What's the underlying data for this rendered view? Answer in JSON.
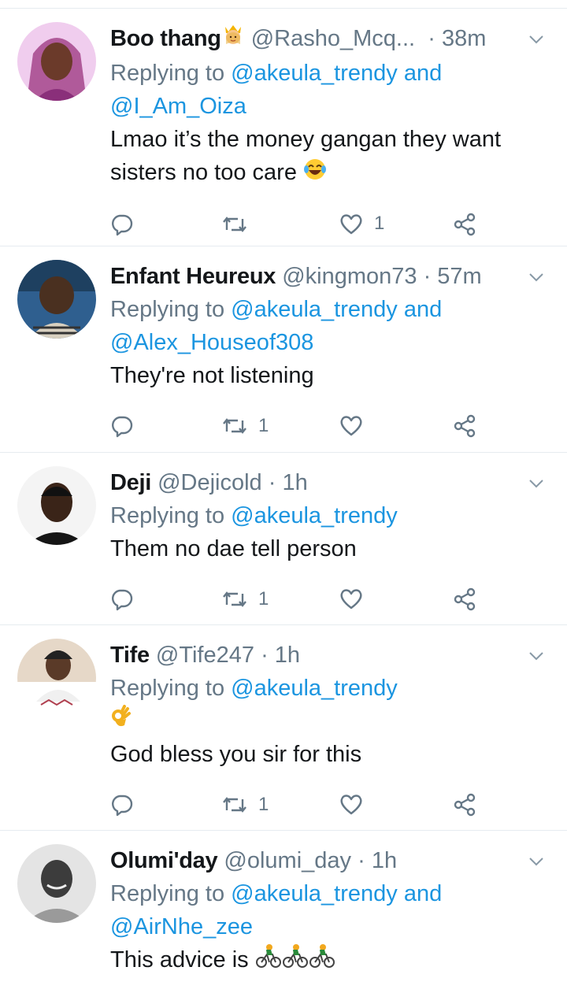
{
  "tweets": [
    {
      "name": "Boo thang",
      "handle": "@Rasho_Mcq...",
      "separator": "·",
      "time": "38m",
      "reply_prefix": "Replying to",
      "mentions": [
        "@akeula_trendy",
        "@I_Am_Oiza"
      ],
      "joiner": "and",
      "text": "Lmao it’s the money gangan they want sisters no too care",
      "retweets": "",
      "likes": "1",
      "avatar_colors": [
        "#e9c7f2",
        "#6b2f6e"
      ]
    },
    {
      "name": "Enfant Heureux",
      "handle": "@kingmon73",
      "separator": "·",
      "time": "57m",
      "reply_prefix": "Replying to",
      "mentions": [
        "@akeula_trendy",
        "@Alex_Houseof308"
      ],
      "joiner": "and",
      "text": "They're not listening",
      "retweets": "1",
      "likes": "",
      "avatar_colors": [
        "#2a5a8a",
        "#4a3020"
      ]
    },
    {
      "name": "Deji",
      "handle": "@Dejicold",
      "separator": "·",
      "time": "1h",
      "reply_prefix": "Replying to",
      "mentions": [
        "@akeula_trendy"
      ],
      "joiner": "",
      "text": "Them no dae tell person",
      "retweets": "1",
      "likes": "",
      "avatar_colors": [
        "#f2f2f2",
        "#3a2418"
      ]
    },
    {
      "name": "Tife",
      "handle": "@Tife247",
      "separator": "·",
      "time": "1h",
      "reply_prefix": "Replying to",
      "mentions": [
        "@akeula_trendy"
      ],
      "joiner": "",
      "text": "God bless you sir for this",
      "retweets": "1",
      "likes": "",
      "avatar_colors": [
        "#e8dcd0",
        "#5a3a28"
      ]
    },
    {
      "name": "Olumi'day",
      "handle": "@olumi_day",
      "separator": "·",
      "time": "1h",
      "reply_prefix": "Replying to",
      "mentions": [
        "@akeula_trendy",
        "@AirNhe_zee"
      ],
      "joiner": "and",
      "text": "This advice is",
      "retweets": "",
      "likes": "",
      "avatar_colors": [
        "#d8d8d8",
        "#555555"
      ]
    }
  ],
  "icons": {
    "reply": "reply-icon",
    "retweet": "retweet-icon",
    "like": "heart-icon",
    "share": "share-icon",
    "menu": "chevron-down-icon"
  },
  "colors": {
    "text": "#14171a",
    "secondary": "#657786",
    "link": "#1b95e0",
    "divider": "#e6ecf0"
  }
}
